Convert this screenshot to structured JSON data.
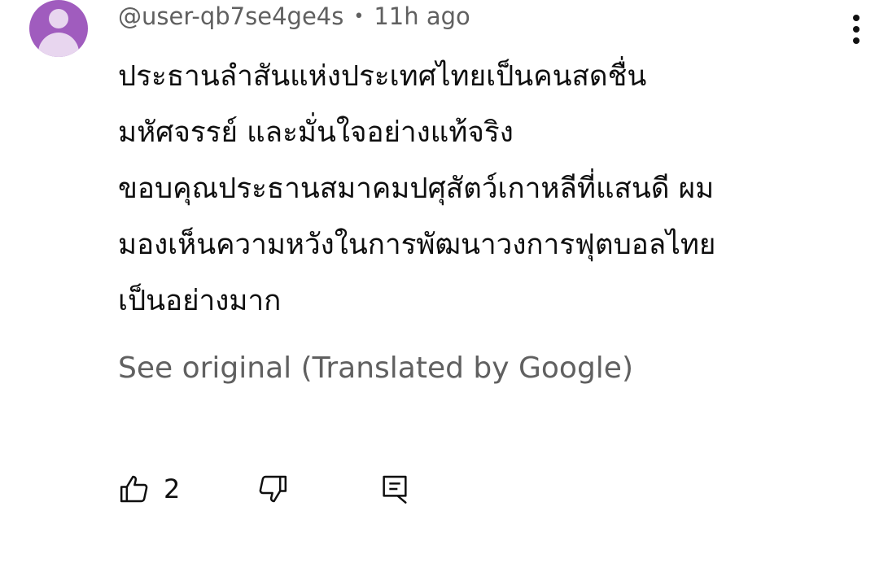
{
  "comment": {
    "author": "@user-qb7se4ge4s",
    "separator": "•",
    "time": "11h ago",
    "text_lines": [
      "ประธานลำสันแห่งประเทศไทยเป็นคนสดชื่น",
      "มหัศจรรย์ และมั่นใจอย่างแท้จริง",
      "ขอบคุณประธานสมาคมปศุสัตว์เกาหลีที่แสนดี ผม",
      "มองเห็นความหวังในการพัฒนาวงการฟุตบอลไทย",
      "เป็นอย่างมาก"
    ],
    "see_original": "See original (Translated by Google)"
  },
  "actions": {
    "like_count": "2"
  },
  "icons": {
    "avatar": "default-user-avatar",
    "more": "vertical-ellipsis-icon",
    "like": "thumbs-up-icon",
    "dislike": "thumbs-down-icon",
    "reply": "comment-reply-icon"
  },
  "colors": {
    "avatar_bg": "#a05cbe",
    "secondary_text": "#606060",
    "primary_text": "#0f0f0f"
  }
}
